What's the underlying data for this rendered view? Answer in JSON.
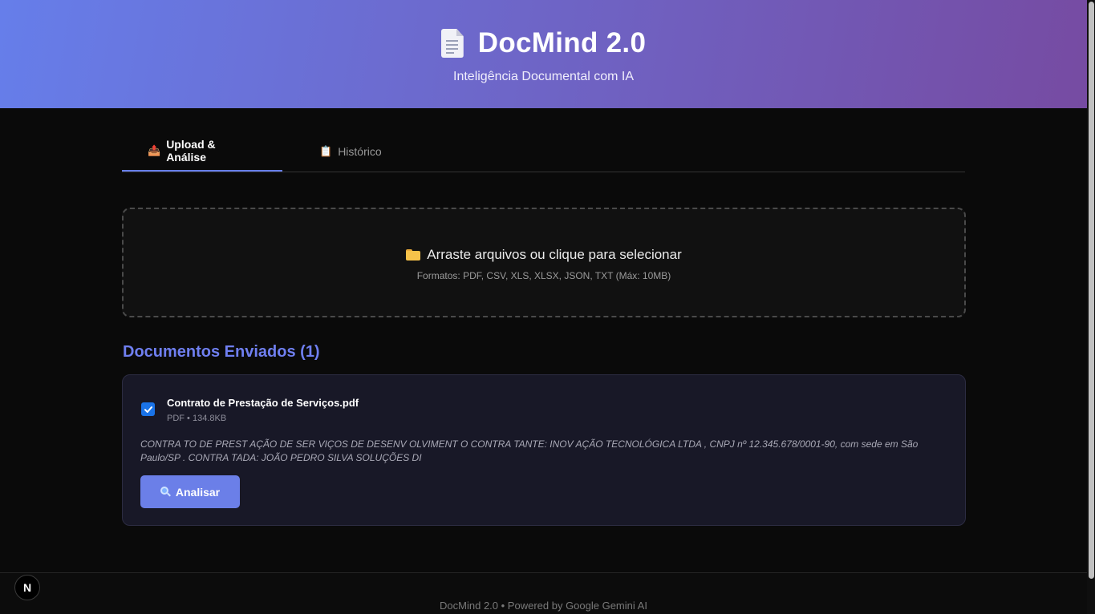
{
  "header": {
    "icon": "document-icon",
    "title": "DocMind 2.0",
    "subtitle": "Inteligência Documental com IA",
    "gradient": [
      "#667eea",
      "#764ba2"
    ]
  },
  "tabs": [
    {
      "icon": "📤",
      "label": "Upload & Análise",
      "active": true
    },
    {
      "icon": "📋",
      "label": "Histórico",
      "active": false
    }
  ],
  "dropzone": {
    "icon": "folder-icon",
    "title": "Arraste arquivos ou clique para selecionar",
    "formats": "Formatos: PDF, CSV, XLS, XLSX, JSON, TXT (Máx: 10MB)"
  },
  "documents": {
    "title": "Documentos Enviados (1)",
    "items": [
      {
        "checked": true,
        "name": "Contrato de Prestação de Serviços.pdf",
        "meta": "PDF • 134.8KB",
        "preview": "CONTRA TO DE PREST AÇÃO DE SER VIÇOS DE DESENV OLVIMENT O CONTRA TANTE: INOV AÇÃO TECNOLÓGICA LTDA , CNPJ nº 12.345.678/0001-90, com sede em São Paulo/SP . CONTRA TADA: JOÃO PEDRO SILVA SOLUÇÕES DI",
        "action_icon": "magnifier-icon",
        "action_label": "Analisar"
      }
    ]
  },
  "footer": {
    "text": "DocMind 2.0 • Powered by Google Gemini AI"
  },
  "dev_badge": "N",
  "colors": {
    "accent": "#667eea",
    "section_title": "#6f7ff0",
    "button": "#6b7fe8",
    "checkbox": "#1a73e8"
  }
}
